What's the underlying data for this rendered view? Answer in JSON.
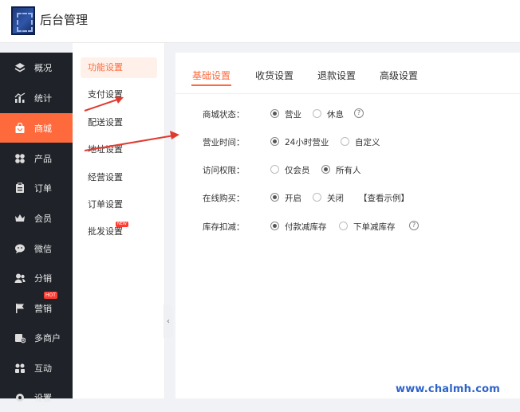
{
  "app": {
    "title": "后台管理"
  },
  "sidebar": {
    "items": [
      {
        "label": "概况",
        "icon": "layers-icon"
      },
      {
        "label": "统计",
        "icon": "chart-icon"
      },
      {
        "label": "商城",
        "icon": "shop-bag-icon",
        "active": true
      },
      {
        "label": "产品",
        "icon": "grid-icon"
      },
      {
        "label": "订单",
        "icon": "clipboard-icon"
      },
      {
        "label": "会员",
        "icon": "crown-icon"
      },
      {
        "label": "微信",
        "icon": "wechat-icon"
      },
      {
        "label": "分销",
        "icon": "users-icon"
      },
      {
        "label": "营销",
        "icon": "flag-icon",
        "badge": "HOT"
      },
      {
        "label": "多商户",
        "icon": "store-plus-icon"
      },
      {
        "label": "互动",
        "icon": "interact-icon"
      },
      {
        "label": "设置",
        "icon": "gear-icon"
      }
    ]
  },
  "subnav": {
    "items": [
      {
        "label": "功能设置",
        "active": true
      },
      {
        "label": "支付设置"
      },
      {
        "label": "配送设置"
      },
      {
        "label": "地址设置"
      },
      {
        "label": "经营设置"
      },
      {
        "label": "订单设置"
      },
      {
        "label": "批发设置",
        "badge": "NEW"
      }
    ]
  },
  "tabs": [
    {
      "label": "基础设置",
      "active": true
    },
    {
      "label": "收货设置"
    },
    {
      "label": "退款设置"
    },
    {
      "label": "高级设置"
    }
  ],
  "settings": {
    "store_status": {
      "label": "商城状态：",
      "options": [
        "营业",
        "休息"
      ],
      "selected": "营业"
    },
    "business_hours": {
      "label": "营业时间：",
      "options": [
        "24小时营业",
        "自定义"
      ],
      "selected": "24小时营业"
    },
    "access": {
      "label": "访问权限：",
      "options": [
        "仅会员",
        "所有人"
      ],
      "selected": "所有人"
    },
    "online_purchase": {
      "label": "在线购买：",
      "options": [
        "开启",
        "关闭"
      ],
      "selected": "开启",
      "link": "【查看示例】"
    },
    "stock_deduct": {
      "label": "库存扣减：",
      "options": [
        "付款减库存",
        "下单减库存"
      ],
      "selected": "付款减库存"
    }
  },
  "help_symbol": "?",
  "collapse_symbol": "‹",
  "watermark": "www.chalmh.com",
  "colors": {
    "accent": "#ff6a3d",
    "sidebar_bg": "#1f2329",
    "arrow": "#e03a2f",
    "watermark": "#2e63c9"
  }
}
